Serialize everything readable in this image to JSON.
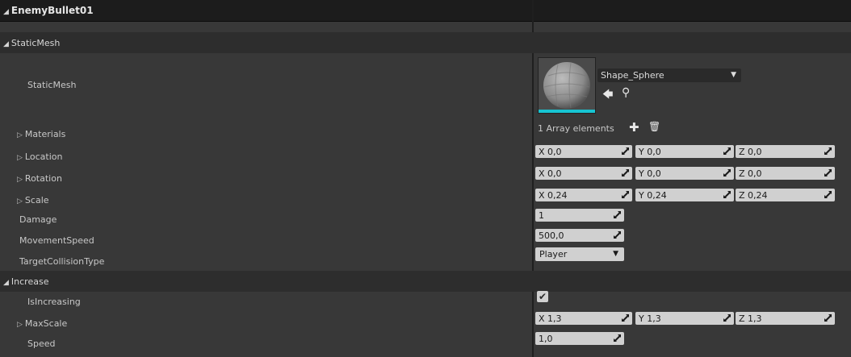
{
  "header": {
    "title": "EnemyBullet01"
  },
  "sections": {
    "static_mesh": "StaticMesh",
    "increase": "Increase"
  },
  "props": {
    "static_mesh": {
      "label": "StaticMesh",
      "asset": "Shape_Sphere"
    },
    "materials": {
      "label": "Materials",
      "value": "1 Array elements"
    },
    "location": {
      "label": "Location",
      "x": "0,0",
      "y": "0,0",
      "z": "0,0"
    },
    "rotation": {
      "label": "Rotation",
      "x": "0,0",
      "y": "0,0",
      "z": "0,0"
    },
    "scale": {
      "label": "Scale",
      "x": "0,24",
      "y": "0,24",
      "z": "0,24"
    },
    "damage": {
      "label": "Damage",
      "value": "1"
    },
    "movement_speed": {
      "label": "MovementSpeed",
      "value": "500,0"
    },
    "target_collision": {
      "label": "TargetCollisionType",
      "value": "Player"
    },
    "is_increasing": {
      "label": "IsIncreasing",
      "checked": true
    },
    "max_scale": {
      "label": "MaxScale",
      "x": "1,3",
      "y": "1,3",
      "z": "1,3"
    },
    "speed": {
      "label": "Speed",
      "value": "1,0"
    }
  },
  "axis": {
    "x": "X",
    "y": "Y",
    "z": "Z"
  }
}
